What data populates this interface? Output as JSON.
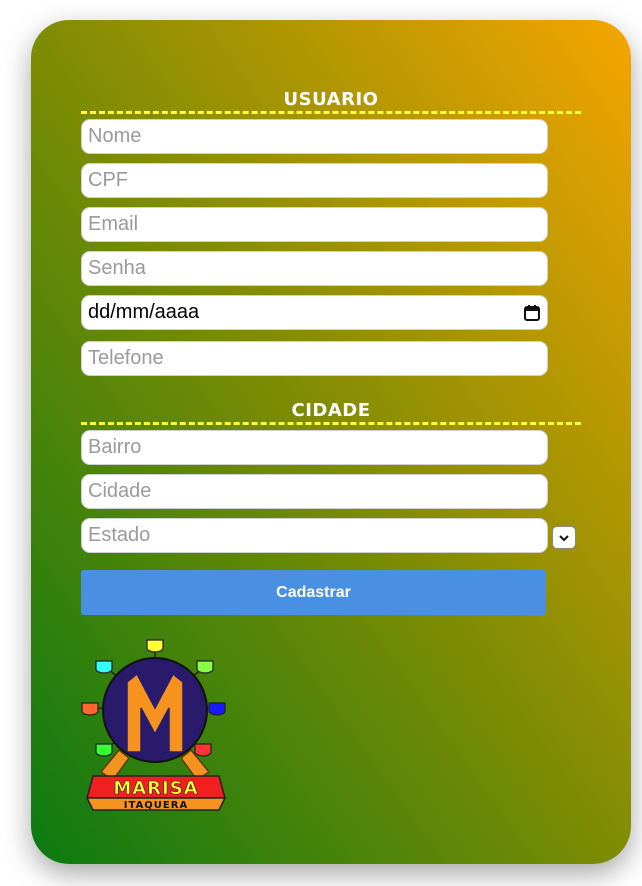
{
  "usuario": {
    "title": "USUARIO",
    "fields": [
      {
        "placeholder": "Nome"
      },
      {
        "placeholder": "CPF"
      },
      {
        "placeholder": "Email"
      },
      {
        "placeholder": "Senha"
      },
      {
        "value": "dd/mm/aaaa"
      },
      {
        "placeholder": "Telefone"
      }
    ]
  },
  "cidade": {
    "title": "CIDADE",
    "fields": [
      {
        "placeholder": "Bairro"
      },
      {
        "placeholder": "Cidade"
      },
      {
        "placeholder": "Estado"
      }
    ]
  },
  "submit_label": "Cadastrar",
  "logo": {
    "name": "MARISA",
    "subtitle": "ITAQUERA"
  },
  "colors": {
    "gradient_start": "#0a7a12",
    "gradient_mid": "#7f8c04",
    "gradient_end": "#f5a500",
    "underline": "#ffff33",
    "button": "#4a90e2"
  },
  "icons": [
    "calendar-icon",
    "chevron-down-icon",
    "ferris-wheel-logo"
  ]
}
